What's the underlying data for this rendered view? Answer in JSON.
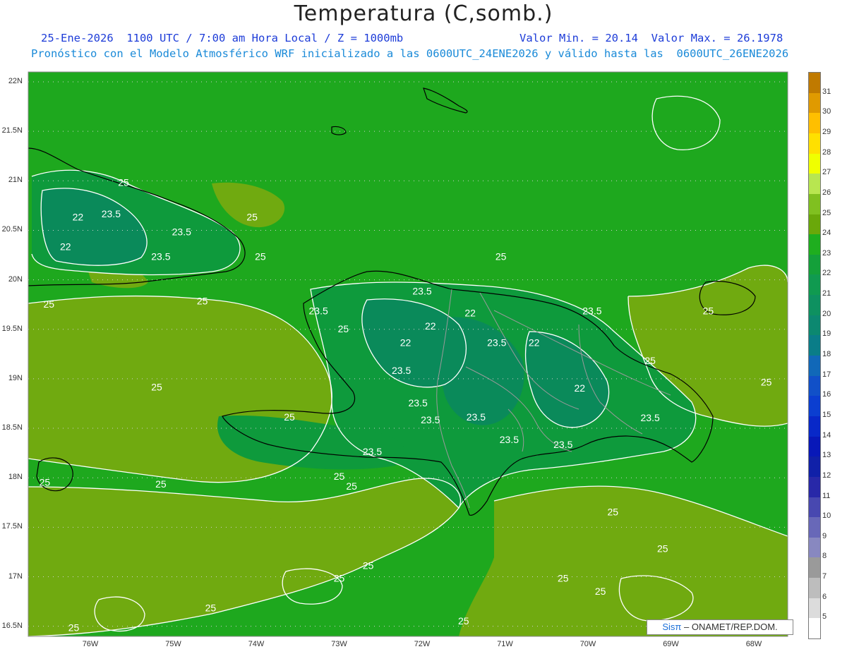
{
  "title": "Temperatura (C,somb.)",
  "subtitle_left": "25-Ene-2026  1100 UTC / 7:00 am Hora Local / Z = 1000mb",
  "subtitle_right": "Valor Min. = 20.14  Valor Max. = 26.1978",
  "subtitle2": "Pronóstico con el Modelo Atmosférico WRF inicializado a las 0600UTC_24ENE2026 y válido hasta las  0600UTC_26ENE2026",
  "credit_brand": "Sisπ",
  "credit_text": "– ONAMET/REP.DOM.",
  "lat_labels": [
    "22N",
    "21.5N",
    "21N",
    "20.5N",
    "20N",
    "19.5N",
    "19N",
    "18.5N",
    "18N",
    "17.5N",
    "17N",
    "16.5N"
  ],
  "lon_labels": [
    "76W",
    "75W",
    "74W",
    "73W",
    "72W",
    "71W",
    "70W",
    "69W",
    "68W"
  ],
  "legend_values": [
    "31",
    "30",
    "29",
    "28",
    "27",
    "26",
    "25",
    "24",
    "23",
    "22",
    "21",
    "20",
    "19",
    "18",
    "17",
    "16",
    "15",
    "14",
    "13",
    "12",
    "11",
    "10",
    "9",
    "8",
    "7",
    "6",
    "5"
  ],
  "legend_colors": [
    "#c07a00",
    "#e09a00",
    "#ffbf00",
    "#ffe000",
    "#f0ff00",
    "#b8e650",
    "#80c020",
    "#6aa80a",
    "#1fae1f",
    "#14a03a",
    "#109a50",
    "#0e9160",
    "#0c8870",
    "#0a7d88",
    "#1168b8",
    "#1150c8",
    "#0b3ed0",
    "#0828c8",
    "#0818b8",
    "#1020a8",
    "#2828a8",
    "#4848b0",
    "#6868b8",
    "#8888c0",
    "#9a9a9a",
    "#bdbdbd",
    "#dcdcdc",
    "#ffffff"
  ],
  "colors": {
    "sea_24": "#1ea81e",
    "warm_25": "#70aa10",
    "cool_23": "#0e9a3c",
    "cool_22": "#0a8a5a",
    "contour": "#ffffff",
    "coast": "#000000",
    "border": "#9a9a9a"
  },
  "contour_labels": [
    {
      "text": "25",
      "lon": -75.6,
      "lat": 20.95
    },
    {
      "text": "22",
      "lon": -76.15,
      "lat": 20.6
    },
    {
      "text": "23.5",
      "lon": -75.75,
      "lat": 20.63
    },
    {
      "text": "22",
      "lon": -76.3,
      "lat": 20.3
    },
    {
      "text": "23.5",
      "lon": -74.9,
      "lat": 20.45
    },
    {
      "text": "23.5",
      "lon": -75.15,
      "lat": 20.2
    },
    {
      "text": "25",
      "lon": -74.05,
      "lat": 20.6
    },
    {
      "text": "25",
      "lon": -73.95,
      "lat": 20.2
    },
    {
      "text": "25",
      "lon": -76.5,
      "lat": 19.72
    },
    {
      "text": "25",
      "lon": -74.65,
      "lat": 19.75
    },
    {
      "text": "25",
      "lon": -71.05,
      "lat": 20.2
    },
    {
      "text": "23.5",
      "lon": -72.0,
      "lat": 19.85
    },
    {
      "text": "23.5",
      "lon": -73.25,
      "lat": 19.65
    },
    {
      "text": "25",
      "lon": -72.95,
      "lat": 19.47
    },
    {
      "text": "22",
      "lon": -71.42,
      "lat": 19.63
    },
    {
      "text": "22",
      "lon": -71.9,
      "lat": 19.5
    },
    {
      "text": "22",
      "lon": -72.2,
      "lat": 19.33
    },
    {
      "text": "23.5",
      "lon": -71.1,
      "lat": 19.33
    },
    {
      "text": "22",
      "lon": -70.65,
      "lat": 19.33
    },
    {
      "text": "23.5",
      "lon": -69.95,
      "lat": 19.65
    },
    {
      "text": "25",
      "lon": -68.55,
      "lat": 19.65
    },
    {
      "text": "25",
      "lon": -69.25,
      "lat": 19.15
    },
    {
      "text": "25",
      "lon": -67.85,
      "lat": 18.93
    },
    {
      "text": "23.5",
      "lon": -72.25,
      "lat": 19.05
    },
    {
      "text": "22",
      "lon": -70.1,
      "lat": 18.87
    },
    {
      "text": "23.5",
      "lon": -72.05,
      "lat": 18.72
    },
    {
      "text": "23.5",
      "lon": -71.9,
      "lat": 18.55
    },
    {
      "text": "23.5",
      "lon": -71.35,
      "lat": 18.58
    },
    {
      "text": "23.5",
      "lon": -69.25,
      "lat": 18.57
    },
    {
      "text": "23.5",
      "lon": -70.95,
      "lat": 18.35
    },
    {
      "text": "23.5",
      "lon": -70.3,
      "lat": 18.3
    },
    {
      "text": "23.5",
      "lon": -72.6,
      "lat": 18.23
    },
    {
      "text": "25",
      "lon": -75.2,
      "lat": 18.88
    },
    {
      "text": "25",
      "lon": -73.6,
      "lat": 18.58
    },
    {
      "text": "25",
      "lon": -75.15,
      "lat": 17.9
    },
    {
      "text": "25",
      "lon": -76.55,
      "lat": 17.92
    },
    {
      "text": "25",
      "lon": -73.0,
      "lat": 17.98
    },
    {
      "text": "25",
      "lon": -72.85,
      "lat": 17.88
    },
    {
      "text": "25",
      "lon": -69.7,
      "lat": 17.62
    },
    {
      "text": "25",
      "lon": -69.1,
      "lat": 17.25
    },
    {
      "text": "25",
      "lon": -72.65,
      "lat": 17.08
    },
    {
      "text": "25",
      "lon": -73.0,
      "lat": 16.95
    },
    {
      "text": "25",
      "lon": -70.3,
      "lat": 16.95
    },
    {
      "text": "25",
      "lon": -69.85,
      "lat": 16.82
    },
    {
      "text": "25",
      "lon": -74.55,
      "lat": 16.65
    },
    {
      "text": "25",
      "lon": -76.2,
      "lat": 16.45
    },
    {
      "text": "25",
      "lon": -71.5,
      "lat": 16.52
    }
  ]
}
